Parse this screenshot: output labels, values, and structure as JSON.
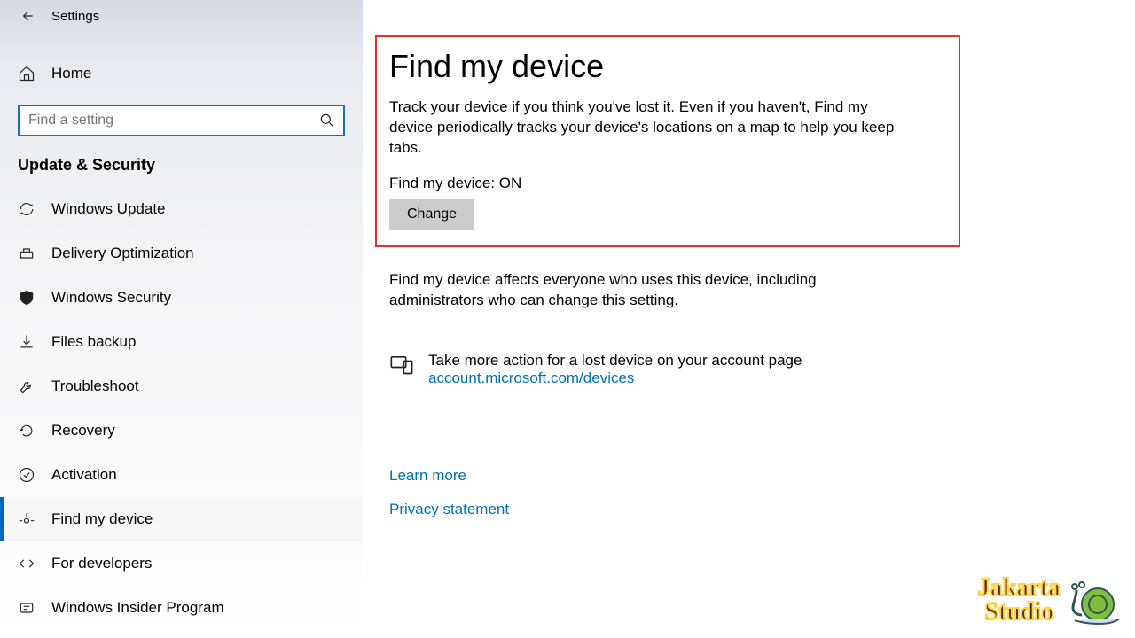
{
  "header": {
    "title": "Settings"
  },
  "sidebar": {
    "home": "Home",
    "search_placeholder": "Find a setting",
    "section": "Update & Security",
    "items": [
      {
        "label": "Windows Update"
      },
      {
        "label": "Delivery Optimization"
      },
      {
        "label": "Windows Security"
      },
      {
        "label": "Files backup"
      },
      {
        "label": "Troubleshoot"
      },
      {
        "label": "Recovery"
      },
      {
        "label": "Activation"
      },
      {
        "label": "Find my device"
      },
      {
        "label": "For developers"
      },
      {
        "label": "Windows Insider Program"
      }
    ]
  },
  "main": {
    "title": "Find my device",
    "description": "Track your device if you think you've lost it. Even if you haven't, Find my device periodically tracks your device's locations on a map to help you keep tabs.",
    "status_label": "Find my device: ON",
    "change_button": "Change",
    "note": "Find my device affects everyone who uses this device, including administrators who can change this setting.",
    "account_action": "Take more action for a lost device on your account page",
    "account_link": "account.microsoft.com/devices",
    "learn_more": "Learn more",
    "privacy": "Privacy statement"
  },
  "watermark": {
    "line1": "Jakarta",
    "line2": "Studio"
  }
}
